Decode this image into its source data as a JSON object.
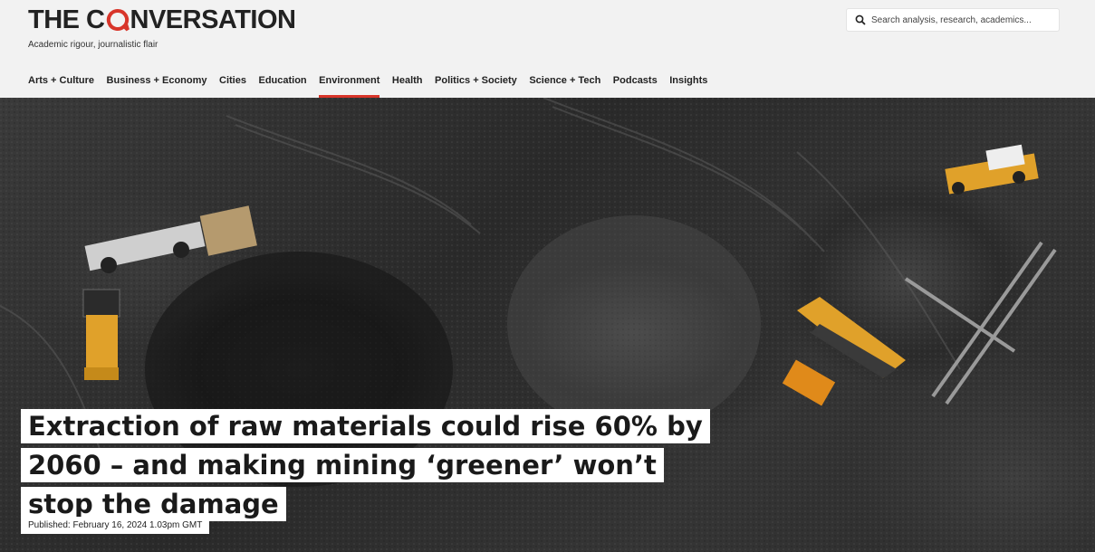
{
  "brand": {
    "logo_left": "THE C",
    "logo_right": "NVERSATION",
    "tagline": "Academic rigour, journalistic flair"
  },
  "search": {
    "placeholder": "Search analysis, research, academics...",
    "icon": "search-icon"
  },
  "nav": {
    "items": [
      "Arts + Culture",
      "Business + Economy",
      "Cities",
      "Education",
      "Environment",
      "Health",
      "Politics + Society",
      "Science + Tech",
      "Podcasts",
      "Insights"
    ],
    "active": "Environment"
  },
  "article": {
    "headline": "Extraction of raw materials could rise 60% by 2060 – and making mining ‘greener’ won’t stop the damage",
    "published": "Published: February 16, 2024 1.03pm GMT"
  },
  "colors": {
    "accent": "#d8352a",
    "header_bg": "#f2f2f2",
    "link_bar": "#1a3fd6"
  }
}
